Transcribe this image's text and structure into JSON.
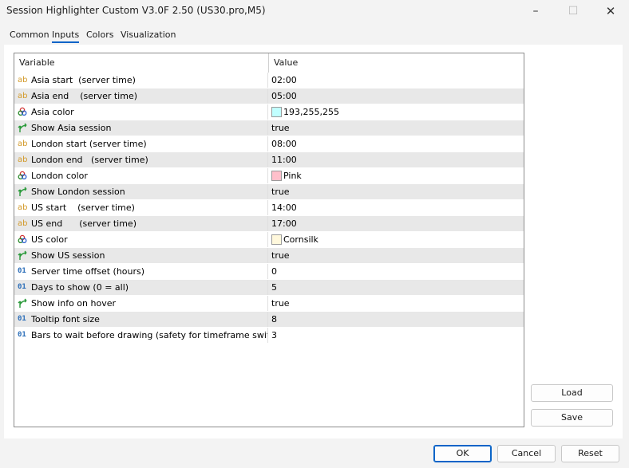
{
  "window": {
    "title": "Session Highlighter Custom V3.0F 2.50 (US30.pro,M5)",
    "minimize": "–",
    "maximize": "☐",
    "close": "✕"
  },
  "tabs": [
    "Common",
    "Inputs",
    "Colors",
    "Visualization"
  ],
  "active_tab": "Inputs",
  "grid": {
    "col_variable": "Variable",
    "col_value": "Value",
    "rows": [
      {
        "type": "ab",
        "icon": "ab",
        "label": "Asia start  (server time)",
        "value": "02:00"
      },
      {
        "type": "ab",
        "icon": "ab",
        "label": "Asia end    (server time)",
        "value": "05:00"
      },
      {
        "type": "color",
        "label": "Asia color",
        "value": "193,255,255",
        "swatch": "#c1ffff"
      },
      {
        "type": "bool",
        "label": "Show Asia session",
        "value": "true"
      },
      {
        "type": "ab",
        "icon": "ab",
        "label": "London start (server time)",
        "value": "08:00"
      },
      {
        "type": "ab",
        "icon": "ab",
        "label": "London end   (server time)",
        "value": "11:00"
      },
      {
        "type": "color",
        "label": "London color",
        "value": "Pink",
        "swatch": "#ffc0cb"
      },
      {
        "type": "bool",
        "label": "Show London session",
        "value": "true"
      },
      {
        "type": "ab",
        "icon": "ab",
        "label": "US start    (server time)",
        "value": "14:00"
      },
      {
        "type": "ab",
        "icon": "ab",
        "label": "US end      (server time)",
        "value": "17:00"
      },
      {
        "type": "color",
        "label": "US color",
        "value": "Cornsilk",
        "swatch": "#fff8dc"
      },
      {
        "type": "bool",
        "label": "Show US session",
        "value": "true"
      },
      {
        "type": "num",
        "icon": "01",
        "label": "Server time offset (hours)",
        "value": "0"
      },
      {
        "type": "num",
        "icon": "01",
        "label": "Days to show (0 = all)",
        "value": "5"
      },
      {
        "type": "bool",
        "label": "Show info on hover",
        "value": "true"
      },
      {
        "type": "num",
        "icon": "01",
        "label": "Tooltip font size",
        "value": "8"
      },
      {
        "type": "num",
        "icon": "01",
        "label": "Bars to wait before drawing (safety for timeframe switching)",
        "value": "3"
      }
    ]
  },
  "side_buttons": {
    "load": "Load",
    "save": "Save"
  },
  "bottom_buttons": {
    "ok": "OK",
    "cancel": "Cancel",
    "reset": "Reset"
  }
}
